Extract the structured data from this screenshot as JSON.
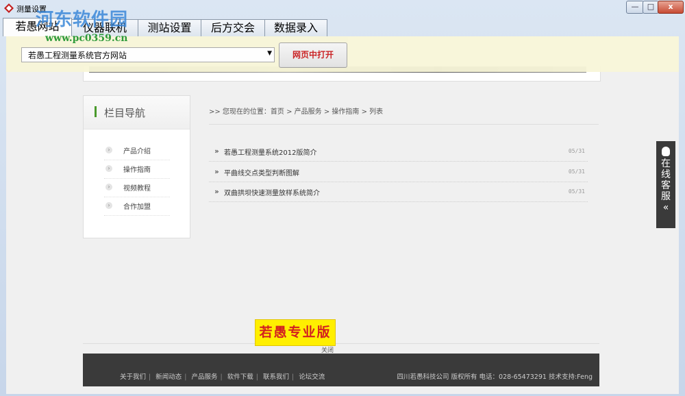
{
  "window": {
    "title": "测量设置",
    "controls": {
      "minimize": "—",
      "maximize": "□",
      "close": "x"
    }
  },
  "watermark": {
    "text": "河东软件园",
    "url": "www.pc0359.cn"
  },
  "tabs": [
    {
      "label": "若愚网站",
      "active": true
    },
    {
      "label": "仪器联机",
      "active": false
    },
    {
      "label": "测站设置",
      "active": false
    },
    {
      "label": "后方交会",
      "active": false
    },
    {
      "label": "数据录入",
      "active": false
    }
  ],
  "toolbar": {
    "site_select_value": "若愚工程测量系统官方网站",
    "open_button": "网页中打开"
  },
  "nav": {
    "title": "栏目导航",
    "items": [
      {
        "label": "产品介绍"
      },
      {
        "label": "操作指南"
      },
      {
        "label": "视频教程"
      },
      {
        "label": "合作加盟"
      }
    ]
  },
  "breadcrumb": {
    "text": ">>  您现在的位置：首页  > 产品服务  > 操作指南  > 列表"
  },
  "articles": [
    {
      "arrow": "»",
      "title": "若愚工程测量系统2012版简介",
      "date": "05/31"
    },
    {
      "arrow": "»",
      "title": "平曲线交点类型判断图解",
      "date": "05/31"
    },
    {
      "arrow": "»",
      "title": "双曲拱坝快速测量放样系统简介",
      "date": "05/31"
    }
  ],
  "float_service": {
    "text": "在线客服",
    "chevron": "«"
  },
  "promo": {
    "label": "若愚专业版",
    "close": "关闭"
  },
  "footer": {
    "links": [
      "关于我们",
      "新闻动态",
      "产品服务",
      "软件下载",
      "联系我们",
      "论坛交流"
    ],
    "copyright": "四川若愚科技公司 版权所有 电话：028-65473291 技术支持:Feng"
  },
  "colors": {
    "accent_green": "#4a9a2c",
    "button_red": "#c8191b",
    "footer_bg": "#3a3a3a",
    "promo_yellow": "#ffef00"
  }
}
